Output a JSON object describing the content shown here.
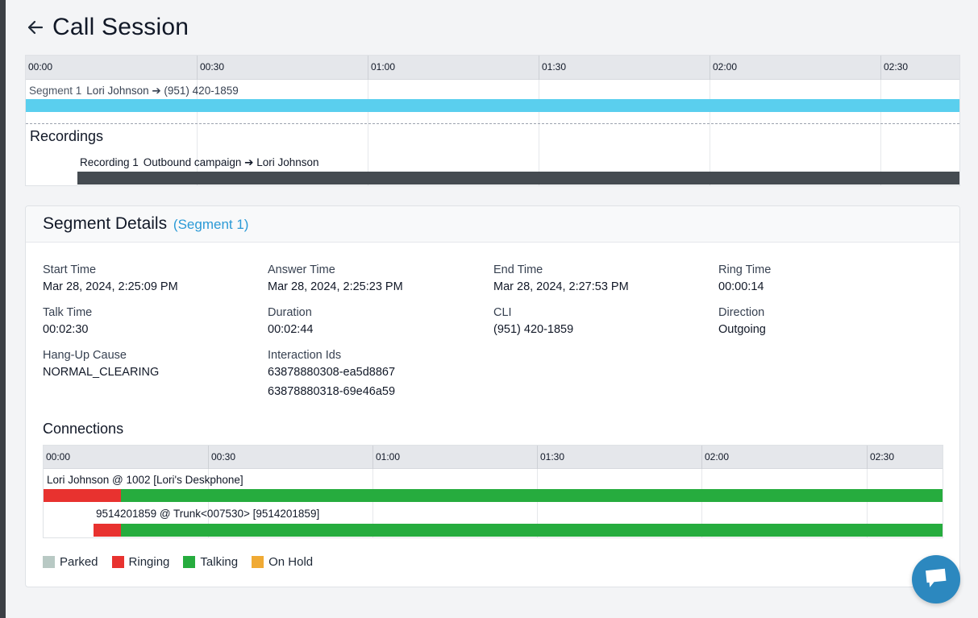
{
  "page": {
    "title": "Call Session"
  },
  "timeline": {
    "ticks": [
      "00:00",
      "00:30",
      "01:00",
      "01:30",
      "02:00",
      "02:30"
    ],
    "segment": {
      "label": "Segment 1",
      "description": "Lori Johnson ➔ (951) 420-1859"
    },
    "recordings_title": "Recordings",
    "recording": {
      "label": "Recording 1",
      "description": "Outbound campaign ➔ Lori Johnson"
    }
  },
  "details": {
    "title": "Segment Details",
    "segment_link": "(Segment 1)",
    "fields": {
      "start_time": {
        "label": "Start Time",
        "value": "Mar 28, 2024, 2:25:09 PM"
      },
      "answer_time": {
        "label": "Answer Time",
        "value": "Mar 28, 2024, 2:25:23 PM"
      },
      "end_time": {
        "label": "End Time",
        "value": "Mar 28, 2024, 2:27:53 PM"
      },
      "ring_time": {
        "label": "Ring Time",
        "value": "00:00:14"
      },
      "talk_time": {
        "label": "Talk Time",
        "value": "00:02:30"
      },
      "duration": {
        "label": "Duration",
        "value": "00:02:44"
      },
      "cli": {
        "label": "CLI",
        "value": "(951) 420-1859"
      },
      "direction": {
        "label": "Direction",
        "value": "Outgoing"
      },
      "hangup_cause": {
        "label": "Hang-Up Cause",
        "value": "NORMAL_CLEARING"
      },
      "interaction_ids": {
        "label": "Interaction Ids",
        "values": [
          "63878880308-ea5d8867",
          "63878880318-69e46a59"
        ]
      }
    }
  },
  "connections": {
    "title": "Connections",
    "ticks": [
      "00:00",
      "00:30",
      "01:00",
      "01:30",
      "02:00",
      "02:30"
    ],
    "rows": [
      {
        "label": "Lori Johnson @ 1002 [Lori's Deskphone]"
      },
      {
        "label": "9514201859 @ Trunk<007530> [9514201859]"
      }
    ]
  },
  "legend": [
    {
      "label": "Parked",
      "color": "#b8c9c4"
    },
    {
      "label": "Ringing",
      "color": "#e8322f"
    },
    {
      "label": "Talking",
      "color": "#26ac3e"
    },
    {
      "label": "On Hold",
      "color": "#f0aa34"
    }
  ],
  "colors": {
    "segment_bar": "#5acfee",
    "recording_bar": "#454b51",
    "accent": "#2b9ad6",
    "chat_button": "#2c88bf"
  }
}
